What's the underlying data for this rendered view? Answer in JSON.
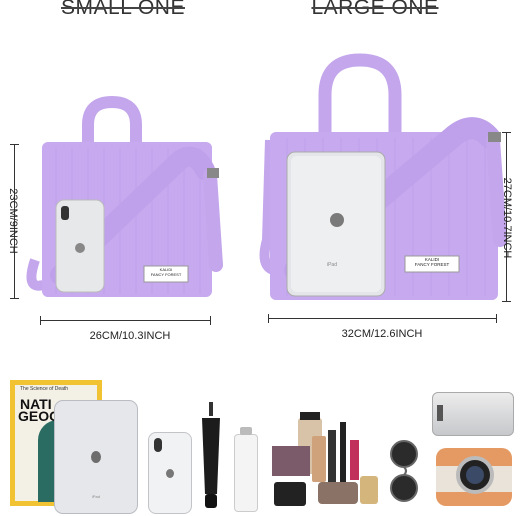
{
  "headings": {
    "small": "SMALL ONE",
    "large": "LARGE ONE"
  },
  "small_bag": {
    "height_label": "23CM/9INCH",
    "width_label": "26CM/10.3INCH",
    "tag_brand": "KALIDI",
    "tag_line": "FANCY FOREST"
  },
  "large_bag": {
    "height_label": "27CM/10.7INCH",
    "width_label": "32CM/12.6INCH",
    "tag_brand": "KALIDI",
    "tag_line": "FANCY FOREST",
    "ipad_label": "iPad"
  },
  "items_row": {
    "magazine_header": "The Science of Death",
    "magazine_title_1": "NATI",
    "magazine_title_2": "GEOGR",
    "tablet_label": "iPad"
  },
  "colors": {
    "bag": "#c6a9ee",
    "bag_shadow": "#b597e2",
    "strap": "#c4a6ec",
    "silver": "#dfe1e4",
    "magazine_yellow": "#f1c232"
  }
}
